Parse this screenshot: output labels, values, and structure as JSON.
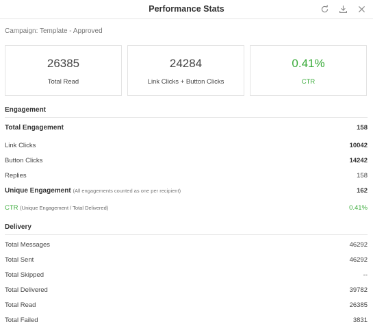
{
  "header": {
    "title": "Performance Stats"
  },
  "campaign": "Campaign: Template - Approved",
  "cards": [
    {
      "value": "26385",
      "label": "Total Read"
    },
    {
      "value": "24284",
      "label": "Link Clicks + Button Clicks"
    },
    {
      "value": "0.41%",
      "label": "CTR"
    }
  ],
  "engagement": {
    "heading": "Engagement",
    "total_label": "Total Engagement",
    "total_value": "158",
    "link_clicks_label": "Link Clicks",
    "link_clicks_value": "10042",
    "button_clicks_label": "Button Clicks",
    "button_clicks_value": "14242",
    "replies_label": "Replies",
    "replies_value": "158",
    "unique_label": "Unique Engagement",
    "unique_note": "(All engagements counted as one per recipient)",
    "unique_value": "162",
    "ctr_label": "CTR",
    "ctr_note": "(Unique Engagement / Total Delivered)",
    "ctr_value": "0.41%"
  },
  "delivery": {
    "heading": "Delivery",
    "rows": [
      {
        "label": "Total Messages",
        "value": "46292"
      },
      {
        "label": "Total Sent",
        "value": "46292"
      },
      {
        "label": "Total Skipped",
        "value": "--"
      },
      {
        "label": "Total Delivered",
        "value": "39782"
      },
      {
        "label": "Total Read",
        "value": "26385"
      },
      {
        "label": "Total Failed",
        "value": "3831"
      }
    ]
  },
  "colors": {
    "accent_green": "#3aab3a",
    "text": "#333333",
    "muted": "#777777"
  },
  "icons": [
    "refresh-icon",
    "download-icon",
    "close-icon"
  ]
}
